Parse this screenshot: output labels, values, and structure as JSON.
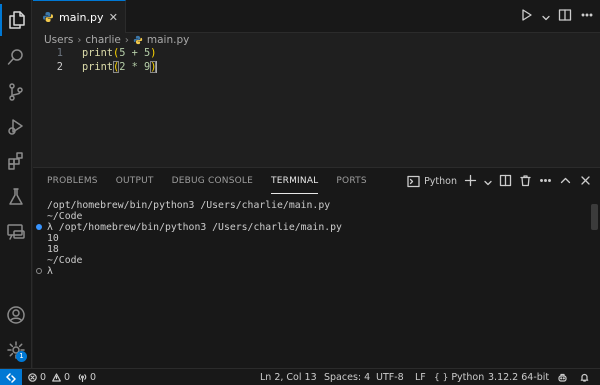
{
  "tab": {
    "filename": "main.py",
    "close_glyph": "✕"
  },
  "breadcrumb": {
    "items": [
      "Users",
      "charlie",
      "main.py"
    ],
    "separator": "›"
  },
  "editor": {
    "lines": [
      {
        "number": "1",
        "fn": "print",
        "open": "(",
        "args": "5 + 5",
        "close": ")"
      },
      {
        "number": "2",
        "fn": "print",
        "open": "(",
        "args": "2 * 9",
        "close": ")"
      }
    ],
    "current_line": 2
  },
  "panel": {
    "tabs": [
      "PROBLEMS",
      "OUTPUT",
      "DEBUG CONSOLE",
      "TERMINAL",
      "PORTS"
    ],
    "active_tab": "TERMINAL",
    "terminal_name": "Python",
    "terminal_lines": [
      {
        "text": "/opt/homebrew/bin/python3 /Users/charlie/main.py",
        "decoration": "none"
      },
      {
        "text": "~/Code",
        "decoration": "none"
      },
      {
        "text": "λ /opt/homebrew/bin/python3 /Users/charlie/main.py",
        "decoration": "success"
      },
      {
        "text": "10",
        "decoration": "none"
      },
      {
        "text": "18",
        "decoration": "none"
      },
      {
        "text": "~/Code",
        "decoration": "none"
      },
      {
        "text": "λ",
        "decoration": "empty"
      }
    ]
  },
  "activity": {
    "items": [
      "files-icon",
      "search-icon",
      "source-control-icon",
      "run-debug-icon",
      "extensions-icon",
      "testing-icon",
      "remote-explorer-icon"
    ],
    "bottom": [
      "account-icon",
      "settings-gear-icon"
    ],
    "settings_badge": "1"
  },
  "status": {
    "errors": "0",
    "warnings": "0",
    "ports": "0",
    "cursor_position": "Ln 2, Col 13",
    "indentation": "Spaces: 4",
    "encoding": "UTF-8",
    "eol": "LF",
    "language": "Python",
    "interpreter": "3.12.2 64-bit"
  },
  "colors": {
    "accent": "#0078d4",
    "background": "#1f1f1f",
    "sidebar": "#181818"
  }
}
